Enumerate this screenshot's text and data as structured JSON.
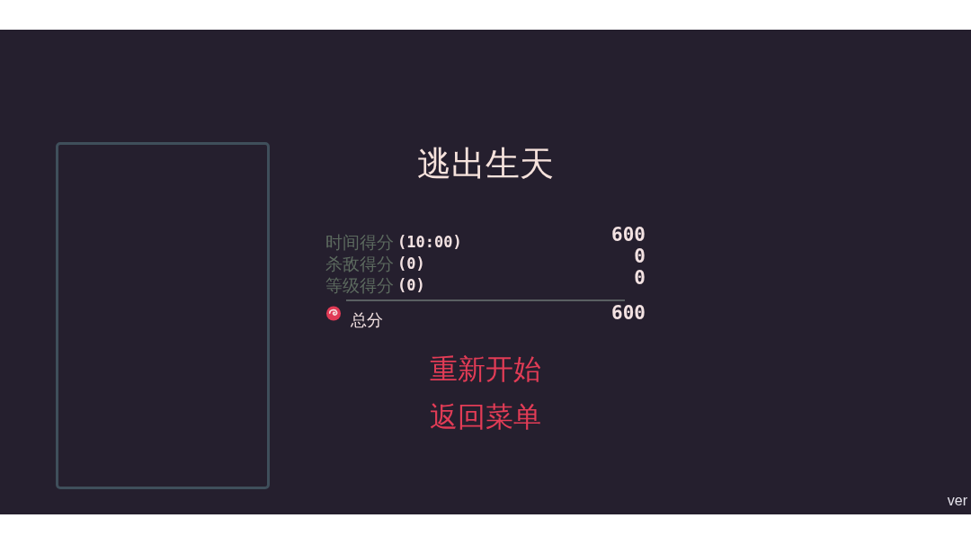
{
  "title": "逃出生天",
  "score_rows": [
    {
      "label": "时间得分",
      "detail": "(10:00)",
      "value": "600"
    },
    {
      "label": "杀敌得分",
      "detail": "(0)",
      "value": "0"
    },
    {
      "label": "等级得分",
      "detail": "(0)",
      "value": "0"
    }
  ],
  "total": {
    "label": "总分",
    "value": "600"
  },
  "menu": [
    "重新开始",
    "返回菜单"
  ],
  "version": "ver"
}
